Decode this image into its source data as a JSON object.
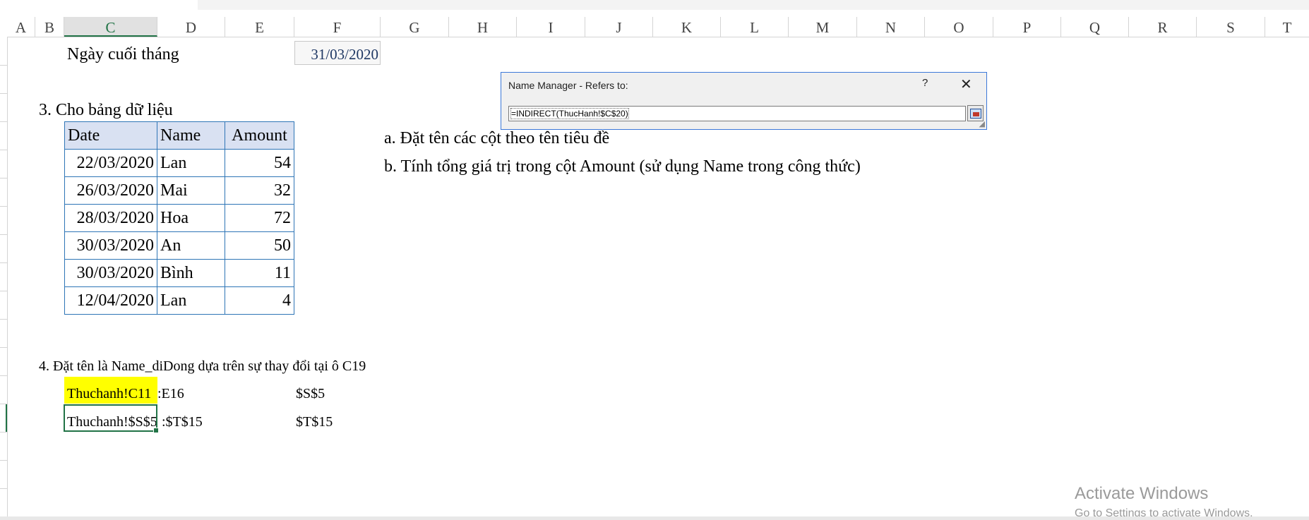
{
  "columns": [
    "A",
    "B",
    "C",
    "D",
    "E",
    "F",
    "G",
    "H",
    "I",
    "J",
    "K",
    "L",
    "M",
    "N",
    "O",
    "P",
    "Q",
    "R",
    "S",
    "T"
  ],
  "selected_column": "C",
  "cells": {
    "end_of_month_label": "Ngày cuối tháng",
    "end_of_month_value": "31/03/2020",
    "section3_title": "3. Cho bảng dữ liệu",
    "task_a": "a. Đặt tên các cột theo tên tiêu đề",
    "task_b": "b. Tính tổng giá trị trong cột Amount (sử dụng Name trong công thức)",
    "section4_title": "4. Đặt tên là Name_diDong dựa trên sự thay đổi tại ô C19",
    "row1_c": "Thuchanh!C11",
    "row1_d": ":E16",
    "row1_f": "$S$5",
    "row2_c": "Thuchanh!$S$5",
    "row2_d": ":$T$15",
    "row2_f": "$T$15"
  },
  "table": {
    "headers": [
      "Date",
      "Name",
      "Amount"
    ],
    "rows": [
      [
        "22/03/2020",
        "Lan",
        "54"
      ],
      [
        "26/03/2020",
        "Mai",
        "32"
      ],
      [
        "28/03/2020",
        "Hoa",
        "72"
      ],
      [
        "30/03/2020",
        "An",
        "50"
      ],
      [
        "30/03/2020",
        "Bình",
        "11"
      ],
      [
        "12/04/2020",
        "Lan",
        "4"
      ]
    ]
  },
  "dialog": {
    "title": "Name Manager - Refers to:",
    "help": "?",
    "close": "✕",
    "formula": "=INDIRECT(ThucHanh!$C$20)"
  },
  "watermark": {
    "line1": "Activate Windows",
    "line2": "Go to Settings to activate Windows."
  },
  "colors": {
    "accent": "#217346",
    "table_border": "#2e75b6",
    "header_fill": "#d9e1f2",
    "highlight": "#ffff00"
  }
}
